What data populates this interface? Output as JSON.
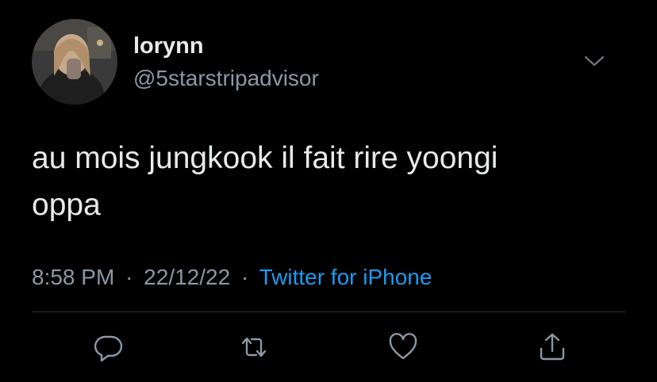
{
  "tweet": {
    "display_name": "lorynn",
    "handle": "@5starstripadvisor",
    "text": "au mois jungkook il fait rire yoongi\noppa",
    "time": "8:58 PM",
    "separator": "·",
    "date": "22/12/22",
    "source": "Twitter for iPhone"
  },
  "icons": {
    "more": "chevron-down-icon",
    "reply": "reply-icon",
    "retweet": "retweet-icon",
    "like": "heart-icon",
    "share": "share-icon"
  },
  "colors": {
    "background": "#000000",
    "text": "#e7e9ea",
    "secondary": "#8b98a5",
    "accent": "#1d9bf0",
    "divider": "#2f3336"
  }
}
